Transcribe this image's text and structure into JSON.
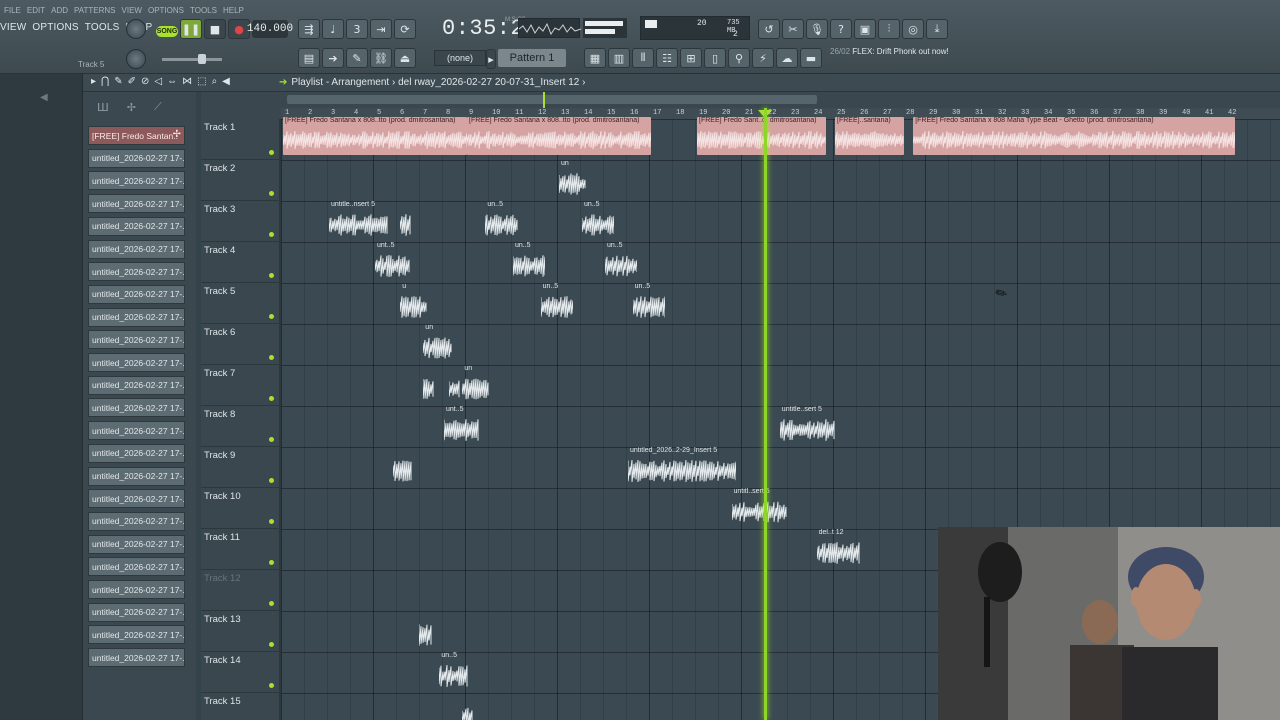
{
  "app": {
    "menu": [
      "VIEW",
      "OPTIONS",
      "TOOLS",
      "HELP"
    ],
    "ghost_menu": [
      "FILE",
      "EDIT",
      "ADD",
      "PATTERNS",
      "VIEW",
      "OPTIONS",
      "TOOLS",
      "HELP"
    ],
    "song_label": "SONG",
    "tempo": "140.000",
    "time": "0:35:24",
    "time_unit": "M:S:CS",
    "cpu_voices": "20",
    "memory": "735 MB",
    "cpu_count": "2",
    "pattern_none": "(none)",
    "pattern_name": "Pattern 1",
    "hint_date": "26/02",
    "hint_text": "FLEX: Drift Phonk out now!",
    "current_track": "Track 5"
  },
  "playlist": {
    "breadcrumb_prefix": "Playlist - Arrangement",
    "breadcrumb_path": "del rway_2026-02-27 20-07-31_Insert 12",
    "ruler": [
      "1",
      "2",
      "3",
      "4",
      "5",
      "6",
      "7",
      "8",
      "9",
      "10",
      "11",
      "12",
      "13",
      "14",
      "15",
      "16",
      "17",
      "18",
      "19",
      "20",
      "21",
      "22",
      "23",
      "24",
      "25",
      "26",
      "27",
      "28",
      "29",
      "30",
      "31",
      "32",
      "33",
      "34",
      "35",
      "36",
      "37",
      "38",
      "39",
      "40",
      "41",
      "42"
    ]
  },
  "patterns": [
    "[FREE] Fredo Santan..",
    "untitled_2026-02-27 17-..",
    "untitled_2026-02-27 17-..",
    "untitled_2026-02-27 17-..",
    "untitled_2026-02-27 17-..",
    "untitled_2026-02-27 17-..",
    "untitled_2026-02-27 17-..",
    "untitled_2026-02-27 17-..",
    "untitled_2026-02-27 17-..",
    "untitled_2026-02-27 17-..",
    "untitled_2026-02-27 17-..",
    "untitled_2026-02-27 17-..",
    "untitled_2026-02-27 17-..",
    "untitled_2026-02-27 17-..",
    "untitled_2026-02-27 17-..",
    "untitled_2026-02-27 17-..",
    "untitled_2026-02-27 17-..",
    "untitled_2026-02-27 17-..",
    "untitled_2026-02-27 17-..",
    "untitled_2026-02-27 17-..",
    "untitled_2026-02-27 17-..",
    "untitled_2026-02-27 17-..",
    "untitled_2026-02-27 17-..",
    "untitled_2026-02-27 17-.."
  ],
  "tracks": [
    {
      "name": "Track 1",
      "muted": false
    },
    {
      "name": "Track 2",
      "muted": false
    },
    {
      "name": "Track 3",
      "muted": false
    },
    {
      "name": "Track 4",
      "muted": false
    },
    {
      "name": "Track 5",
      "muted": false
    },
    {
      "name": "Track 6",
      "muted": false
    },
    {
      "name": "Track 7",
      "muted": false
    },
    {
      "name": "Track 8",
      "muted": false
    },
    {
      "name": "Track 9",
      "muted": false
    },
    {
      "name": "Track 10",
      "muted": false
    },
    {
      "name": "Track 11",
      "muted": false
    },
    {
      "name": "Track 12",
      "muted": true
    },
    {
      "name": "Track 13",
      "muted": false
    },
    {
      "name": "Track 14",
      "muted": false
    },
    {
      "name": "Track 15",
      "muted": false
    }
  ],
  "clips": [
    {
      "track": 1,
      "start": 1,
      "len": 8,
      "style": "red",
      "label": "[FREE] Fredo Santana x 808..tto (prod. dmitrosantana)"
    },
    {
      "track": 1,
      "start": 9,
      "len": 8,
      "style": "red",
      "label": "[FREE] Fredo Santana x 808..tto (prod. dmitrosantana)"
    },
    {
      "track": 1,
      "start": 19,
      "len": 5.6,
      "style": "red",
      "label": "[FREE] Fredo Sant..d. dmitrosantana)"
    },
    {
      "track": 1,
      "start": 25,
      "len": 3,
      "style": "red",
      "label": "[FREE]..santana)"
    },
    {
      "track": 1,
      "start": 28.4,
      "len": 14,
      "style": "red",
      "label": "[FREE] Fredo Santana x 808 Mafia Type Beat - Ghetto (prod. dmitrosantana)"
    },
    {
      "track": 2,
      "start": 13,
      "len": 1.2,
      "style": "gray",
      "label": "un"
    },
    {
      "track": 3,
      "start": 3,
      "len": 2.6,
      "style": "gray",
      "label": "untitle..nsert 5"
    },
    {
      "track": 3,
      "start": 6.1,
      "len": 0.5,
      "style": "gray",
      "label": ""
    },
    {
      "track": 3,
      "start": 9.8,
      "len": 1.4,
      "style": "gray",
      "label": "un..5"
    },
    {
      "track": 3,
      "start": 14,
      "len": 1.4,
      "style": "gray",
      "label": "un..5"
    },
    {
      "track": 4,
      "start": 5,
      "len": 1.5,
      "style": "gray",
      "label": "unt..5"
    },
    {
      "track": 4,
      "start": 11,
      "len": 1.4,
      "style": "gray",
      "label": "un..5"
    },
    {
      "track": 4,
      "start": 15,
      "len": 1.4,
      "style": "gray",
      "label": "un..5"
    },
    {
      "track": 5,
      "start": 6.1,
      "len": 1.2,
      "style": "gray",
      "label": "u"
    },
    {
      "track": 5,
      "start": 12.2,
      "len": 1.4,
      "style": "gray",
      "label": "un..5"
    },
    {
      "track": 5,
      "start": 16.2,
      "len": 1.4,
      "style": "gray",
      "label": "un..5"
    },
    {
      "track": 6,
      "start": 7.1,
      "len": 1.3,
      "style": "gray",
      "label": "un"
    },
    {
      "track": 7,
      "start": 7.1,
      "len": 0.5,
      "style": "gray",
      "label": ""
    },
    {
      "track": 7,
      "start": 8.2,
      "len": 0.5,
      "style": "gray",
      "label": ""
    },
    {
      "track": 7,
      "start": 8.8,
      "len": 1.2,
      "style": "gray",
      "label": "un"
    },
    {
      "track": 8,
      "start": 8,
      "len": 1.5,
      "style": "gray",
      "label": "unt..5"
    },
    {
      "track": 8,
      "start": 22.6,
      "len": 2.4,
      "style": "gray",
      "label": "untitle..sert 5"
    },
    {
      "track": 9,
      "start": 5.8,
      "len": 0.8,
      "style": "gray",
      "label": ""
    },
    {
      "track": 9,
      "start": 16,
      "len": 4.7,
      "style": "gray",
      "label": "untitled_2026..2-29_Insert 5"
    },
    {
      "track": 10,
      "start": 20.5,
      "len": 2.4,
      "style": "gray",
      "label": "untitl..sert 5"
    },
    {
      "track": 11,
      "start": 24.2,
      "len": 1.9,
      "style": "gray",
      "label": "del..t 12"
    },
    {
      "track": 13,
      "start": 6.9,
      "len": 0.6,
      "style": "gray",
      "label": ""
    },
    {
      "track": 14,
      "start": 7.8,
      "len": 1.3,
      "style": "gray",
      "label": "un..5"
    },
    {
      "track": 15,
      "start": 8.8,
      "len": 0.5,
      "style": "gray",
      "label": ""
    }
  ],
  "colors": {
    "accent": "#a7e22e",
    "clip_red": "#d6a3a3",
    "grid": "#3b4a52"
  }
}
